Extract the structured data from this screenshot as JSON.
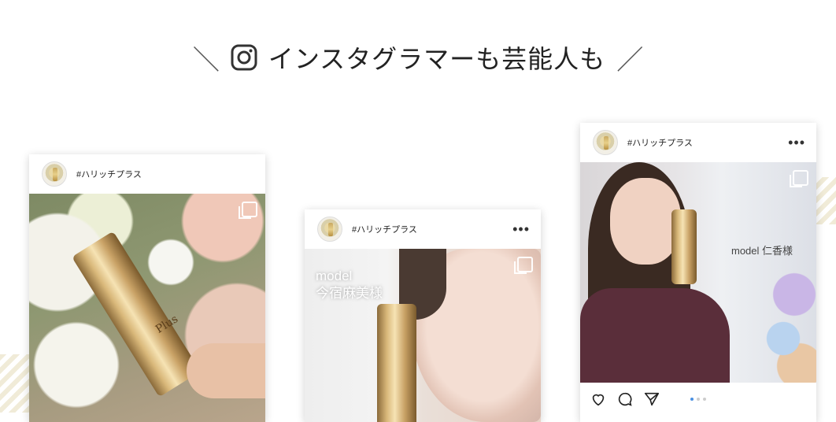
{
  "heading": {
    "left_slash": "＼",
    "text": "インスタグラマーも芸能人も",
    "right_slash": "／"
  },
  "colors": {
    "stripe": "#efe9d3",
    "accent_dot": "#4a90e2"
  },
  "cards": [
    {
      "username": "#ハリッチプラス",
      "more": "",
      "caption": "",
      "bottle_text": "Plus"
    },
    {
      "username": "#ハリッチプラス",
      "more": "•••",
      "caption": "model\n今宿麻美様"
    },
    {
      "username": "#ハリッチプラス",
      "more": "•••",
      "caption": "model 仁香様"
    }
  ],
  "icons": {
    "instagram": "instagram-icon",
    "like": "heart-icon",
    "comment": "comment-icon",
    "share": "send-icon",
    "multi": "carousel-icon"
  }
}
